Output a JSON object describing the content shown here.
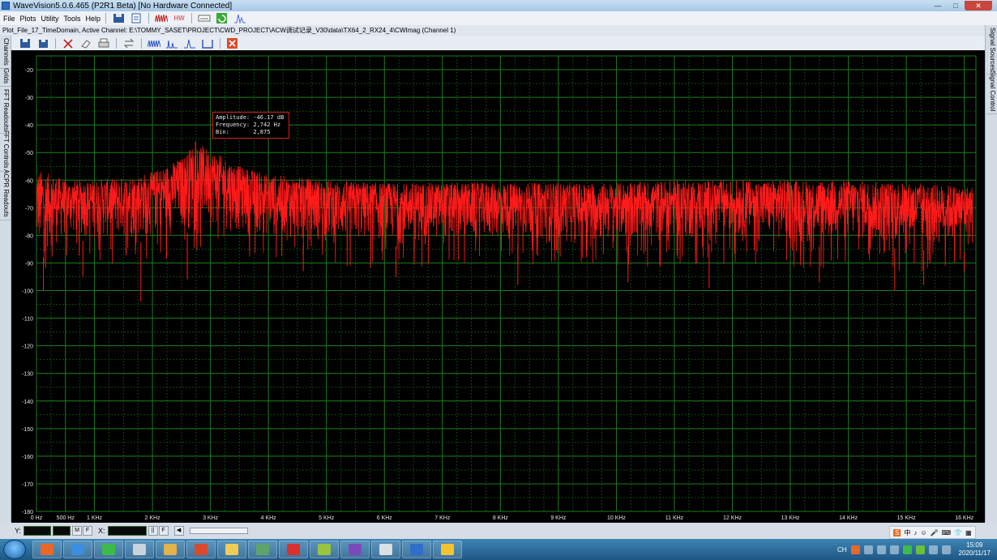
{
  "window": {
    "title": "WaveVision5.0.6.465 (P2R1 Beta)  [No Hardware Connected]",
    "controls": {
      "minimize": "—",
      "maximize": "□",
      "close": "✕"
    }
  },
  "menu": {
    "items": [
      "File",
      "Plots",
      "Utility",
      "Tools",
      "Help"
    ]
  },
  "toolbar": {
    "icons": [
      "save-file-icon",
      "export-icon",
      "wave-analysis-icon",
      "hw-icon",
      "link-icon",
      "refresh-icon",
      "spectrum-icon"
    ],
    "hw_label": "HW"
  },
  "plot_info": "Plot_File_17_TimeDomain,  Active Channel: E:\\TOMMY_SASET\\PROJECT\\CWD_PROJECT\\ACW调试记录_V30\\data\\TX64_2_RX24_4\\CWImag (Channel 1)",
  "left_tabs": [
    "Channels",
    "Grids",
    "FFT Readouts",
    "FFT Controls",
    "ACPR Readouts"
  ],
  "right_tabs": [
    "Signal Sources",
    "Signal Control"
  ],
  "readout": {
    "amplitude": "Amplitude: -46.17 dB",
    "frequency": "Frequency: 2,742 Hz",
    "bin": "Bin:       2,875"
  },
  "status": {
    "y_label": "Y:",
    "x_label": "X:",
    "m_btn": "M",
    "f_btn": "F",
    "pipe_btn": "||",
    "arrow_btn": "◀"
  },
  "ime": {
    "items": [
      "S",
      "中",
      "♪",
      "☺",
      "🎤",
      "⌨",
      "👕",
      "▦"
    ]
  },
  "tray": {
    "lang": "CH"
  },
  "clock": {
    "time": "15:09",
    "date": "2020/11/17"
  },
  "taskbar_apps": [
    {
      "name": "firefox",
      "color": "#e8682a"
    },
    {
      "name": "app-blue",
      "color": "#3c8de0"
    },
    {
      "name": "wechat",
      "color": "#3dbb4a"
    },
    {
      "name": "document",
      "color": "#c9d3dd"
    },
    {
      "name": "paint",
      "color": "#e3b24a"
    },
    {
      "name": "wavevision",
      "color": "#d94a2c"
    },
    {
      "name": "explorer",
      "color": "#f0cc55"
    },
    {
      "name": "screen",
      "color": "#5fa26c"
    },
    {
      "name": "pdf",
      "color": "#d8322f"
    },
    {
      "name": "arrow",
      "color": "#99c43f"
    },
    {
      "name": "visual-studio",
      "color": "#7a4bb8"
    },
    {
      "name": "notes",
      "color": "#d9e0e6"
    },
    {
      "name": "word",
      "color": "#2f6ec9"
    },
    {
      "name": "messenger",
      "color": "#f2c433"
    }
  ],
  "chart_data": {
    "type": "line",
    "title": "",
    "xlabel": "",
    "ylabel": "",
    "ylim": [
      -180,
      -15
    ],
    "xlim": [
      0,
      16200
    ],
    "y_ticks": [
      -20,
      -30,
      -40,
      -50,
      -60,
      -70,
      -80,
      -90,
      -100,
      -110,
      -120,
      -130,
      -140,
      -150,
      -160,
      -170,
      -180
    ],
    "x_ticks": [
      {
        "value": 0,
        "label": "0 Hz"
      },
      {
        "value": 500,
        "label": "500 Hz"
      },
      {
        "value": 1000,
        "label": "1 KHz"
      },
      {
        "value": 2000,
        "label": "2 KHz"
      },
      {
        "value": 3000,
        "label": "3 KHz"
      },
      {
        "value": 4000,
        "label": "4 KHz"
      },
      {
        "value": 5000,
        "label": "5 KHz"
      },
      {
        "value": 6000,
        "label": "6 KHz"
      },
      {
        "value": 7000,
        "label": "7 KHz"
      },
      {
        "value": 8000,
        "label": "8 KHz"
      },
      {
        "value": 9000,
        "label": "9 KHz"
      },
      {
        "value": 10000,
        "label": "10 KHz"
      },
      {
        "value": 11000,
        "label": "11 KHz"
      },
      {
        "value": 12000,
        "label": "12 KHz"
      },
      {
        "value": 13000,
        "label": "13 KHz"
      },
      {
        "value": 14000,
        "label": "14 KHz"
      },
      {
        "value": 15000,
        "label": "15 KHz"
      },
      {
        "value": 16000,
        "label": "16 KHz"
      }
    ],
    "grid": true,
    "series": [
      {
        "color": "#ff1a1a",
        "envelope": {
          "freq": [
            0,
            500,
            1000,
            1500,
            2000,
            2500,
            2742,
            3000,
            3500,
            4000,
            5000,
            6000,
            7000,
            8000,
            9000,
            10000,
            11000,
            12000,
            13000,
            14000,
            15000,
            16000
          ],
          "upper": [
            -56,
            -60,
            -60,
            -59,
            -57,
            -52,
            -46.17,
            -49,
            -55,
            -58,
            -60,
            -61,
            -61,
            -61,
            -61,
            -61,
            -60,
            -60,
            -60,
            -60,
            -61,
            -62
          ],
          "lower": [
            -90,
            -82,
            -82,
            -83,
            -82,
            -80,
            -78,
            -78,
            -80,
            -82,
            -84,
            -84,
            -84,
            -83,
            -84,
            -84,
            -83,
            -83,
            -84,
            -84,
            -85,
            -86
          ],
          "min_dips": [
            [
              120,
              -100
            ],
            [
              800,
              -95
            ],
            [
              1800,
              -104
            ],
            [
              2600,
              -96
            ],
            [
              4600,
              -93
            ],
            [
              6200,
              -95
            ],
            [
              8300,
              -98
            ],
            [
              10200,
              -97
            ],
            [
              11600,
              -99
            ],
            [
              13500,
              -97
            ],
            [
              14800,
              -100
            ],
            [
              15300,
              -98
            ],
            [
              16000,
              -93
            ]
          ]
        },
        "marker": {
          "freq": 2742,
          "amplitude": -46.17
        }
      }
    ]
  }
}
